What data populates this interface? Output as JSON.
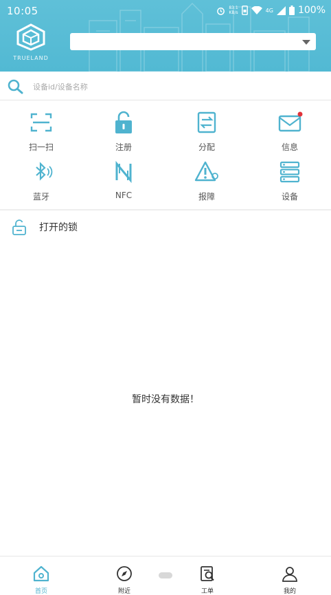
{
  "status_bar": {
    "time": "10:05",
    "net_speed_top": "83.1",
    "net_speed_bottom": "KB/s",
    "signal_label": "4G",
    "battery": "100%"
  },
  "header": {
    "brand": "TRUELAND",
    "select_value": ""
  },
  "search": {
    "placeholder": "设备id/设备名称"
  },
  "grid": {
    "items": [
      {
        "label": "扫一扫",
        "icon": "scan-icon"
      },
      {
        "label": "注册",
        "icon": "lock-icon"
      },
      {
        "label": "分配",
        "icon": "transfer-icon"
      },
      {
        "label": "信息",
        "icon": "mail-icon"
      },
      {
        "label": "蓝牙",
        "icon": "bluetooth-icon"
      },
      {
        "label": "NFC",
        "icon": "nfc-icon"
      },
      {
        "label": "报障",
        "icon": "warning-icon"
      },
      {
        "label": "设备",
        "icon": "device-icon"
      }
    ]
  },
  "section": {
    "title": "打开的锁"
  },
  "empty_message": "暂时没有数据！",
  "tabbar": {
    "tabs": [
      {
        "label": "首页",
        "icon": "home-icon"
      },
      {
        "label": "附近",
        "icon": "compass-icon"
      },
      {
        "label": "工单",
        "icon": "work-order-icon"
      },
      {
        "label": "我的",
        "icon": "user-icon"
      }
    ]
  },
  "colors": {
    "accent": "#4fb3cf",
    "header_bg": "#5fc0d8",
    "badge": "#e0323a"
  }
}
